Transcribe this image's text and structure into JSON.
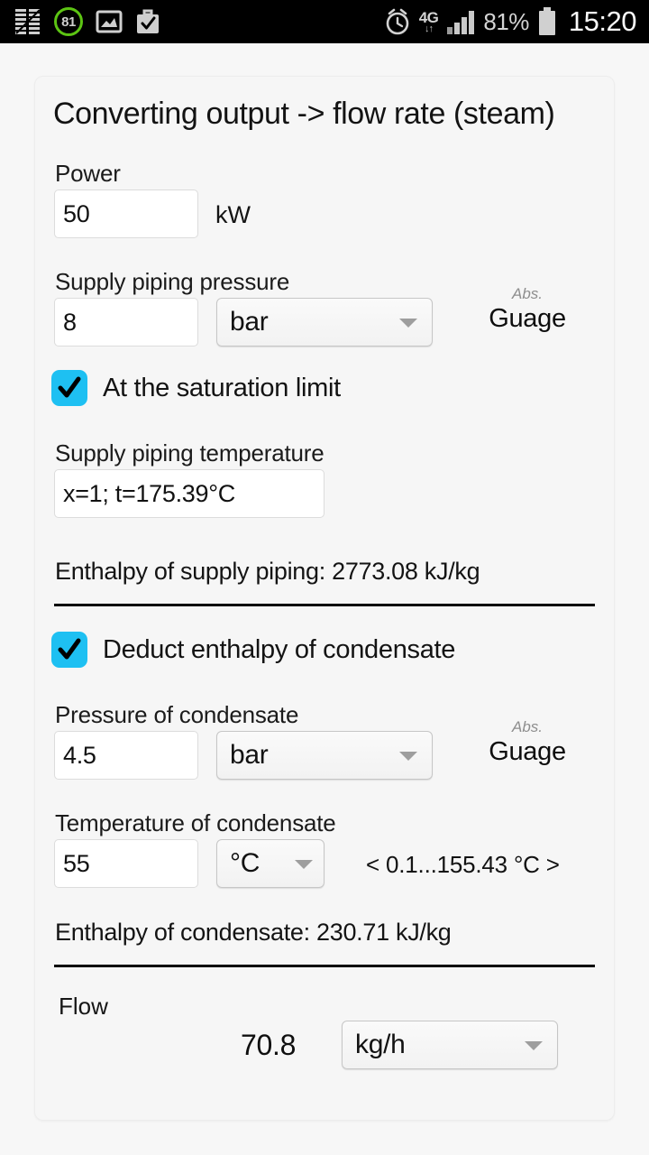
{
  "status_bar": {
    "icons": [
      "ccleaner-icon",
      "battery-ring-icon",
      "gallery-icon",
      "work-profile-icon",
      "alarm-icon",
      "network-4g-icon",
      "signal-bars-icon",
      "battery-icon"
    ],
    "battery_ring_value": "81",
    "network_type": "4G",
    "network_arrows": "↓↑",
    "battery_percent": "81%",
    "clock": "15:20",
    "accent_green": "#5cc413"
  },
  "app": {
    "title": "Converting output -> flow rate (steam)",
    "accent_checkbox": "#1ec0f2"
  },
  "power": {
    "label": "Power",
    "value": "50",
    "unit": "kW"
  },
  "supply_pressure": {
    "label": "Supply piping pressure",
    "value": "8",
    "unit": "bar",
    "mode_small": "Abs.",
    "mode_main": "Guage"
  },
  "saturation": {
    "label": "At the saturation limit",
    "checked": true
  },
  "supply_temperature": {
    "label": "Supply piping temperature",
    "value": "x=1; t=175.39°C"
  },
  "supply_enthalpy": {
    "text": "Enthalpy of supply piping: 2773.08 kJ/kg"
  },
  "deduct_condensate": {
    "label": "Deduct enthalpy of condensate",
    "checked": true
  },
  "condensate_pressure": {
    "label": "Pressure of condensate",
    "value": "4.5",
    "unit": "bar",
    "mode_small": "Abs.",
    "mode_main": "Guage"
  },
  "condensate_temperature": {
    "label": "Temperature of condensate",
    "value": "55",
    "unit": "°C",
    "range": "< 0.1...155.43 °C >"
  },
  "condensate_enthalpy": {
    "text": "Enthalpy of condensate: 230.71 kJ/kg"
  },
  "flow": {
    "label": "Flow",
    "value": "70.8",
    "unit": "kg/h"
  }
}
